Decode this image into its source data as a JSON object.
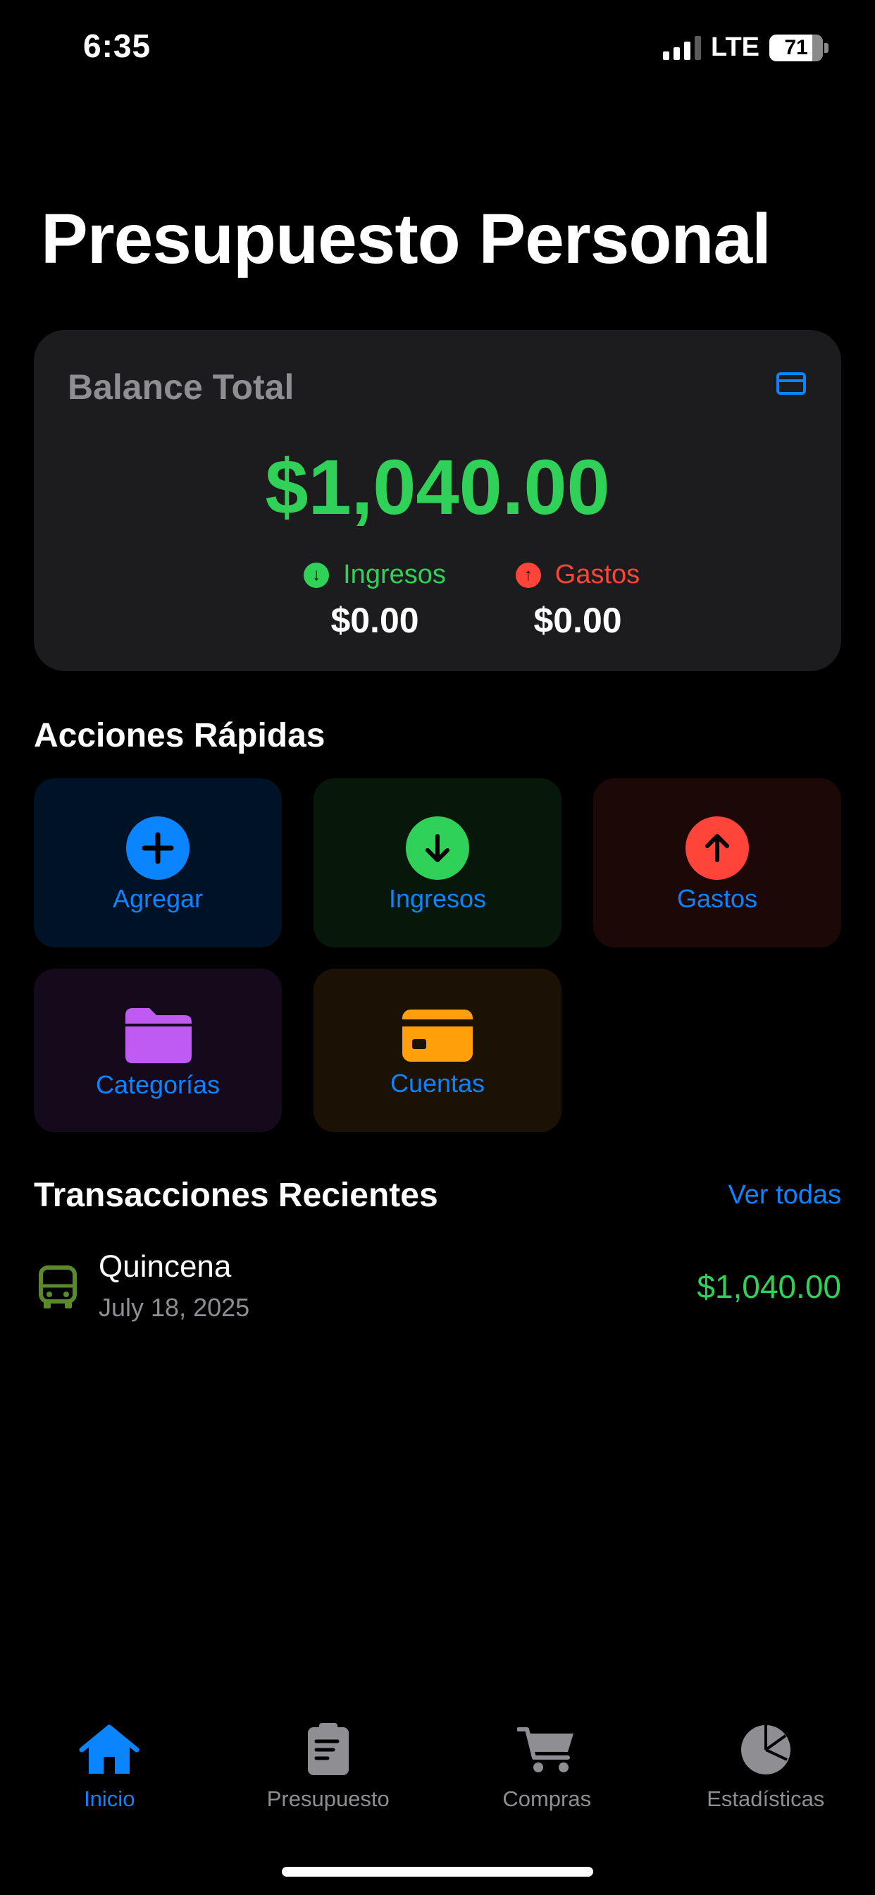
{
  "status_bar": {
    "time": "6:35",
    "network": "LTE",
    "battery": "71"
  },
  "page": {
    "title": "Presupuesto Personal"
  },
  "balance": {
    "label": "Balance Total",
    "amount": "$1,040.00",
    "income": {
      "label": "Ingresos",
      "value": "$0.00",
      "color": "#30d158"
    },
    "expense": {
      "label": "Gastos",
      "value": "$0.00",
      "color": "#ff453a"
    }
  },
  "quick_actions": {
    "title": "Acciones Rápidas",
    "items": [
      {
        "label": "Agregar",
        "icon": "plus-circle-icon",
        "color": "#0a84ff"
      },
      {
        "label": "Ingresos",
        "icon": "arrow-down-circle-icon",
        "color": "#30d158"
      },
      {
        "label": "Gastos",
        "icon": "arrow-up-circle-icon",
        "color": "#ff453a"
      },
      {
        "label": "Categorías",
        "icon": "folder-icon",
        "color": "#bf5af2"
      },
      {
        "label": "Cuentas",
        "icon": "credit-card-icon",
        "color": "#ff9f0a"
      }
    ]
  },
  "recent": {
    "title": "Transacciones Recientes",
    "see_all": "Ver todas",
    "transactions": [
      {
        "name": "Quincena",
        "date": "July 18, 2025",
        "amount": "$1,040.00",
        "icon": "bus-icon"
      }
    ]
  },
  "tab_bar": {
    "tabs": [
      {
        "label": "Inicio",
        "icon": "house-icon",
        "active": true
      },
      {
        "label": "Presupuesto",
        "icon": "clipboard-icon",
        "active": false
      },
      {
        "label": "Compras",
        "icon": "cart-icon",
        "active": false
      },
      {
        "label": "Estadísticas",
        "icon": "pie-chart-icon",
        "active": false
      }
    ]
  }
}
